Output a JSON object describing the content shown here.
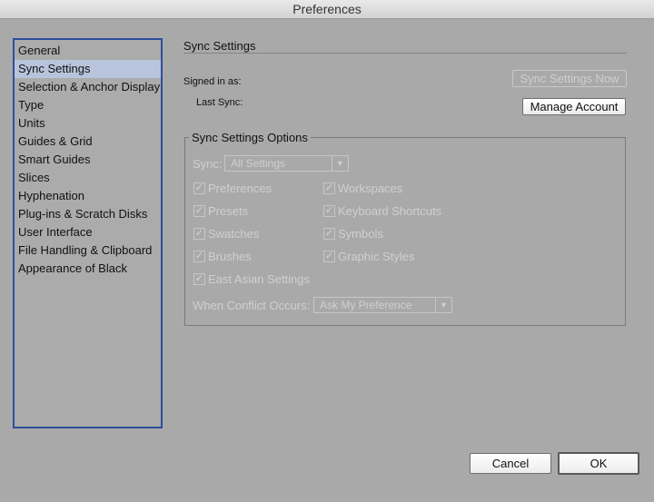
{
  "window": {
    "title": "Preferences"
  },
  "sidebar": {
    "items": [
      "General",
      "Sync Settings",
      "Selection & Anchor Display",
      "Type",
      "Units",
      "Guides & Grid",
      "Smart Guides",
      "Slices",
      "Hyphenation",
      "Plug-ins & Scratch Disks",
      "User Interface",
      "File Handling & Clipboard",
      "Appearance of Black"
    ],
    "selected": "Sync Settings"
  },
  "sync": {
    "section_title": "Sync Settings",
    "signed_in_label": "Signed in as:",
    "last_sync_label": "Last Sync:",
    "sync_now_button": "Sync Settings Now",
    "manage_button": "Manage Account"
  },
  "options": {
    "title": "Sync Settings Options",
    "sync_label": "Sync:",
    "sync_value": "All Settings",
    "checkboxes_left": [
      "Preferences",
      "Presets",
      "Swatches",
      "Brushes",
      "East Asian Settings"
    ],
    "checkboxes_right": [
      "Workspaces",
      "Keyboard Shortcuts",
      "Symbols",
      "Graphic Styles"
    ],
    "conflict_label": "When Conflict Occurs:",
    "conflict_value": "Ask My Preference"
  },
  "footer": {
    "cancel": "Cancel",
    "ok": "OK"
  }
}
